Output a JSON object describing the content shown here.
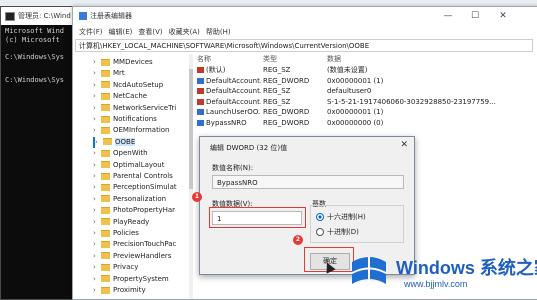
{
  "cmd": {
    "title": "管理员: C:\\Wind",
    "lines": [
      "Microsoft Wind",
      "(c) Microsoft",
      "C:\\Windows\\Sys",
      "C:\\Windows\\Sys"
    ]
  },
  "regedit": {
    "title": "注册表编辑器",
    "menu": [
      "文件(F)",
      "编辑(E)",
      "查看(V)",
      "收藏夹(A)",
      "帮助(H)"
    ],
    "address": "计算机\\HKEY_LOCAL_MACHINE\\SOFTWARE\\Microsoft\\Windows\\CurrentVersion\\OOBE",
    "window_buttons": [
      "—",
      "☐",
      "✕"
    ],
    "tree": [
      {
        "label": "MMDevices"
      },
      {
        "label": "Mrt"
      },
      {
        "label": "NcdAutoSetup"
      },
      {
        "label": "NetCache"
      },
      {
        "label": "NetworkServiceTri"
      },
      {
        "label": "Notifications"
      },
      {
        "label": "OEMInformation"
      },
      {
        "label": "OOBE",
        "selected": true
      },
      {
        "label": "OpenWith"
      },
      {
        "label": "OptimalLayout"
      },
      {
        "label": "Parental Controls"
      },
      {
        "label": "PerceptionSimulat"
      },
      {
        "label": "Personalization"
      },
      {
        "label": "PhotoPropertyHar"
      },
      {
        "label": "PlayReady"
      },
      {
        "label": "Policies"
      },
      {
        "label": "PrecisionTouchPac"
      },
      {
        "label": "PreviewHandlers"
      },
      {
        "label": "Privacy"
      },
      {
        "label": "PropertySystem"
      },
      {
        "label": "Proximity"
      }
    ],
    "columns": {
      "name": "名称",
      "type": "类型",
      "data": "数据"
    },
    "values": [
      {
        "name": "(默认)",
        "type": "REG_SZ",
        "data": "(数值未设置)",
        "kind": "ab"
      },
      {
        "name": "DefaultAccount...",
        "type": "REG_DWORD",
        "data": "0x00000001 (1)",
        "kind": "bin"
      },
      {
        "name": "DefaultAccount...",
        "type": "REG_SZ",
        "data": "defaultuser0",
        "kind": "ab"
      },
      {
        "name": "DefaultAccount...",
        "type": "REG_SZ",
        "data": "S-1-5-21-1917406060-3032928850-23197759...",
        "kind": "ab"
      },
      {
        "name": "LaunchUserOO...",
        "type": "REG_DWORD",
        "data": "0x00000001 (1)",
        "kind": "bin"
      },
      {
        "name": "BypassNRO",
        "type": "REG_DWORD",
        "data": "0x00000000 (0)",
        "kind": "bin"
      }
    ]
  },
  "dialog": {
    "title": "编辑 DWORD (32 位)值",
    "close": "✕",
    "name_label": "数值名称(N):",
    "name_value": "BypassNRO",
    "data_label": "数值数据(V):",
    "data_value": "1",
    "base_label": "基数",
    "hex_label": "十六进制(H)",
    "dec_label": "十进制(D)",
    "selected_base": "hex",
    "ok_label": "确定"
  },
  "annotations": {
    "badge1": "1",
    "badge2": "2"
  },
  "watermark": {
    "brand": "Windows 系统之家",
    "url": "www.bjjmlv.com"
  }
}
